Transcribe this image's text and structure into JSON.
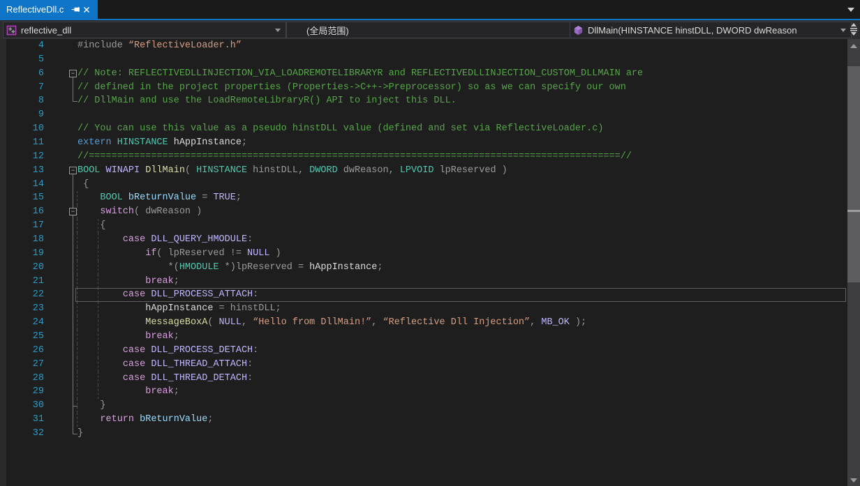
{
  "tab": {
    "title": "ReflectiveDll.c"
  },
  "navbar": {
    "project": "reflective_dll",
    "scope": "(全局范围)",
    "member": "DllMain(HINSTANCE hinstDLL, DWORD dwReason"
  },
  "colors": {
    "active_tab": "#0e74c8",
    "editor_bg": "#1e1e1e",
    "navbar_bg": "#2d2d30",
    "line_number": "#2f9bc5",
    "comment": "#57a64a",
    "keyword": "#569cd6",
    "control_keyword": "#d8a0df",
    "type": "#4ec9b0",
    "macro": "#beb7ff",
    "function": "#dcdcaa",
    "string": "#d69d85",
    "identifier": "#dcdcdc",
    "parameter": "#9b9b9b",
    "local_variable": "#9cdcfe"
  },
  "icons": {
    "tab_pin": "pin-icon",
    "tab_close": "close-icon",
    "project": "cpp-project-icon",
    "member": "method-cube-icon",
    "splitter": "split-editor-icon"
  },
  "editor": {
    "lines": [
      {
        "n": 4,
        "ind": 0,
        "m": "",
        "g": [],
        "tok": [
          [
            "pp",
            "#include "
          ],
          [
            "st",
            "“ReflectiveLoader.h”"
          ]
        ]
      },
      {
        "n": 5,
        "ind": 0,
        "m": "",
        "g": [],
        "tok": []
      },
      {
        "n": 6,
        "ind": 0,
        "m": "b",
        "g": [],
        "tok": [
          [
            "cm",
            "// Note: REFLECTIVEDLLINJECTION_VIA_LOADREMOTELIBRARYR and REFLECTIVEDLLINJECTION_CUSTOM_DLLMAIN are"
          ]
        ]
      },
      {
        "n": 7,
        "ind": 0,
        "m": "v",
        "g": [],
        "tok": [
          [
            "cm",
            "// defined in the project properties (Properties->C++->Preprocessor) so as we can specify our own"
          ]
        ]
      },
      {
        "n": 8,
        "ind": 0,
        "m": "c",
        "g": [],
        "tok": [
          [
            "cm",
            "// DllMain and use the LoadRemoteLibraryR() API to inject this DLL."
          ]
        ]
      },
      {
        "n": 9,
        "ind": 0,
        "m": "",
        "g": [],
        "tok": []
      },
      {
        "n": 10,
        "ind": 0,
        "m": "",
        "g": [],
        "tok": [
          [
            "cm",
            "// You can use this value as a pseudo hinstDLL value (defined and set via ReflectiveLoader.c)"
          ]
        ]
      },
      {
        "n": 11,
        "ind": 0,
        "m": "",
        "g": [],
        "tok": [
          [
            "kw",
            "extern "
          ],
          [
            "ty",
            "HINSTANCE "
          ],
          [
            "pl",
            "hAppInstance"
          ],
          [
            "pr",
            ";"
          ]
        ]
      },
      {
        "n": 12,
        "ind": 0,
        "m": "",
        "g": [],
        "tok": [
          [
            "cm",
            "//==============================================================================================//"
          ]
        ]
      },
      {
        "n": 13,
        "ind": 0,
        "m": "b",
        "g": [],
        "tok": [
          [
            "ty",
            "BOOL "
          ],
          [
            "mc",
            "WINAPI "
          ],
          [
            "fn",
            "DllMain"
          ],
          [
            "pr",
            "( "
          ],
          [
            "ty",
            "HINSTANCE "
          ],
          [
            "pr",
            "hinstDLL, "
          ],
          [
            "ty",
            "DWORD "
          ],
          [
            "pr",
            "dwReason, "
          ],
          [
            "ty",
            "LPVOID "
          ],
          [
            "pr",
            "lpReserved )"
          ]
        ]
      },
      {
        "n": 14,
        "ind": 1,
        "m": "v",
        "g": [],
        "tok": [
          [
            "pr",
            "{"
          ]
        ]
      },
      {
        "n": 15,
        "ind": 4,
        "m": "v",
        "g": [
          110
        ],
        "tok": [
          [
            "ty",
            "BOOL "
          ],
          [
            "lv",
            "bReturnValue"
          ],
          [
            "pr",
            " = "
          ],
          [
            "mc",
            "TRUE"
          ],
          [
            "pr",
            ";"
          ]
        ]
      },
      {
        "n": 16,
        "ind": 4,
        "m": "vb",
        "g": [
          110
        ],
        "tok": [
          [
            "ck",
            "switch"
          ],
          [
            "pr",
            "( dwReason )"
          ]
        ]
      },
      {
        "n": 17,
        "ind": 4,
        "m": "v",
        "g": [
          110,
          140
        ],
        "tok": [
          [
            "pr",
            "{"
          ]
        ]
      },
      {
        "n": 18,
        "ind": 8,
        "m": "v",
        "g": [
          110,
          140
        ],
        "tok": [
          [
            "ck",
            "case "
          ],
          [
            "mc",
            "DLL_QUERY_HMODULE"
          ],
          [
            "pr",
            ":"
          ]
        ]
      },
      {
        "n": 19,
        "ind": 12,
        "m": "v",
        "g": [
          110,
          140
        ],
        "tok": [
          [
            "ck",
            "if"
          ],
          [
            "pr",
            "( lpReserved != "
          ],
          [
            "mc",
            "NULL"
          ],
          [
            "pr",
            " )"
          ]
        ]
      },
      {
        "n": 20,
        "ind": 16,
        "m": "v",
        "g": [
          110,
          140
        ],
        "tok": [
          [
            "pr",
            "*("
          ],
          [
            "ty",
            "HMODULE"
          ],
          [
            "pr",
            " *)lpReserved = "
          ],
          [
            "pl",
            "hAppInstance"
          ],
          [
            "pr",
            ";"
          ]
        ]
      },
      {
        "n": 21,
        "ind": 12,
        "m": "v",
        "g": [
          110,
          140
        ],
        "tok": [
          [
            "ck",
            "break"
          ],
          [
            "pr",
            ";"
          ]
        ]
      },
      {
        "n": 22,
        "ind": 8,
        "m": "v",
        "g": [
          110,
          140
        ],
        "cur": true,
        "tok": [
          [
            "ck",
            "case "
          ],
          [
            "mc",
            "DLL_PROCESS_ATTACH"
          ],
          [
            "pr",
            ":"
          ]
        ]
      },
      {
        "n": 23,
        "ind": 12,
        "m": "v",
        "g": [
          110,
          140
        ],
        "tok": [
          [
            "pl",
            "hAppInstance"
          ],
          [
            "pr",
            " = hinstDLL;"
          ]
        ]
      },
      {
        "n": 24,
        "ind": 12,
        "m": "v",
        "g": [
          110,
          140
        ],
        "tok": [
          [
            "fn",
            "MessageBoxA"
          ],
          [
            "pr",
            "( "
          ],
          [
            "mc",
            "NULL"
          ],
          [
            "pr",
            ", "
          ],
          [
            "st",
            "“Hello from DllMain!”"
          ],
          [
            "pr",
            ", "
          ],
          [
            "st",
            "“Reflective Dll Injection”"
          ],
          [
            "pr",
            ", "
          ],
          [
            "mc",
            "MB_OK"
          ],
          [
            "pr",
            " );"
          ]
        ]
      },
      {
        "n": 25,
        "ind": 12,
        "m": "v",
        "g": [
          110,
          140
        ],
        "tok": [
          [
            "ck",
            "break"
          ],
          [
            "pr",
            ";"
          ]
        ]
      },
      {
        "n": 26,
        "ind": 8,
        "m": "v",
        "g": [
          110,
          140
        ],
        "tok": [
          [
            "ck",
            "case "
          ],
          [
            "mc",
            "DLL_PROCESS_DETACH"
          ],
          [
            "pr",
            ":"
          ]
        ]
      },
      {
        "n": 27,
        "ind": 8,
        "m": "v",
        "g": [
          110,
          140
        ],
        "tok": [
          [
            "ck",
            "case "
          ],
          [
            "mc",
            "DLL_THREAD_ATTACH"
          ],
          [
            "pr",
            ":"
          ]
        ]
      },
      {
        "n": 28,
        "ind": 8,
        "m": "v",
        "g": [
          110,
          140
        ],
        "tok": [
          [
            "ck",
            "case "
          ],
          [
            "mc",
            "DLL_THREAD_DETACH"
          ],
          [
            "pr",
            ":"
          ]
        ]
      },
      {
        "n": 29,
        "ind": 12,
        "m": "v",
        "g": [
          110,
          140
        ],
        "tok": [
          [
            "ck",
            "break"
          ],
          [
            "pr",
            ";"
          ]
        ]
      },
      {
        "n": 30,
        "ind": 4,
        "m": "vc",
        "g": [
          110
        ],
        "tok": [
          [
            "pr",
            "}"
          ]
        ]
      },
      {
        "n": 31,
        "ind": 4,
        "m": "v",
        "g": [
          110
        ],
        "tok": [
          [
            "ck",
            "return "
          ],
          [
            "lv",
            "bReturnValue"
          ],
          [
            "pr",
            ";"
          ]
        ]
      },
      {
        "n": 32,
        "ind": 0,
        "m": "c",
        "g": [],
        "tok": [
          [
            "pr",
            "}"
          ]
        ]
      }
    ]
  }
}
